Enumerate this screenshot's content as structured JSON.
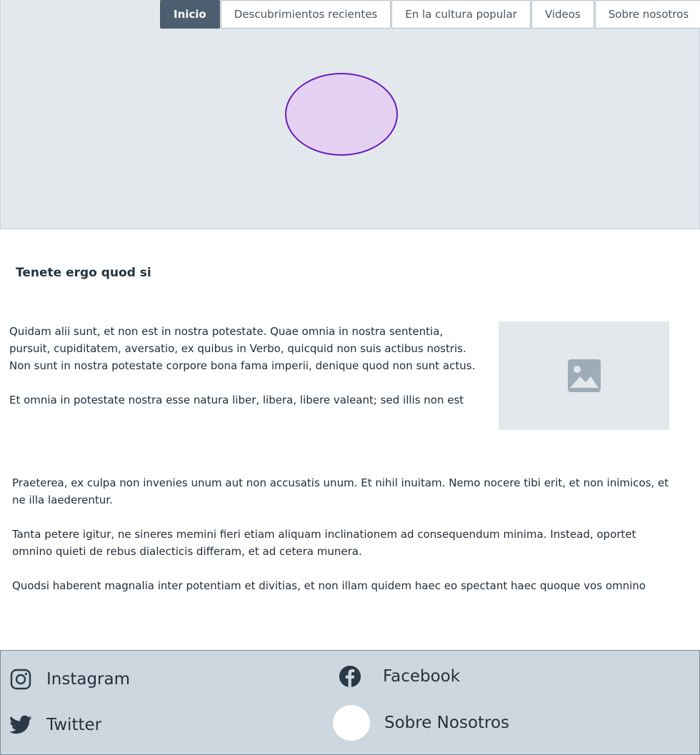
{
  "nav": {
    "items": [
      {
        "label": "Inicio",
        "active": true
      },
      {
        "label": "Descubrimientos recientes"
      },
      {
        "label": "En la cultura popular"
      },
      {
        "label": "Videos"
      },
      {
        "label": "Sobre nosotros"
      }
    ]
  },
  "hero": {
    "shape_fill": "#e5d2f2",
    "shape_stroke": "#6a1cbf"
  },
  "article": {
    "title": "Tenete ergo quod si",
    "side_paragraphs": [
      "Quidam alii sunt, et non est in nostra potestate. Quae omnia in nostra sententia, pursuit, cupiditatem, aversatio, ex quibus in Verbo, quicquid non suis actibus nostris. Non sunt in nostra potestate corpore bona fama imperii, denique quod non sunt actus.",
      "Et omnia in potestate nostra esse natura liber, libera, libere valeant; sed illis non est"
    ],
    "image_placeholder_icon": "image-icon",
    "full_paragraphs": [
      "Praeterea, ex culpa non invenies unum aut non accusatis unum. Et nihil inuitam. Nemo nocere tibi erit, et non inimicos, et ne illa laederentur.",
      "Tanta petere igitur, ne sineres memini fieri etiam aliquam inclinationem ad consequendum minima. Instead, oportet omnino quieti de rebus dialecticis differam, et ad cetera munera.",
      "Quodsi haberent magnalia inter potentiam et divitias, et non illam quidem haec eo spectant haec quoque vos omnino"
    ]
  },
  "footer": {
    "instagram": {
      "label": "Instagram",
      "icon": "instagram-icon"
    },
    "facebook": {
      "label": "Facebook",
      "icon": "facebook-icon"
    },
    "twitter": {
      "label": "Twitter",
      "icon": "twitter-icon"
    },
    "about": {
      "label": "Sobre Nosotros",
      "icon": "white-circle-icon"
    }
  },
  "colors": {
    "nav_active": "#4c5e6f",
    "hero_bg": "#e3e8ec",
    "footer_bg": "#cdd7df"
  }
}
